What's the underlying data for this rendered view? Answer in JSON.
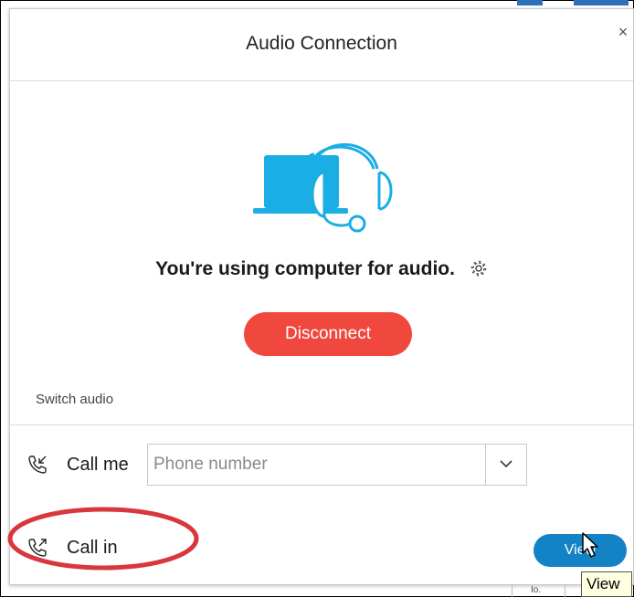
{
  "dialog": {
    "title": "Audio Connection",
    "close_icon": "close-icon",
    "status_text": "You're using computer for audio.",
    "disconnect_label": "Disconnect",
    "switch_audio_label": "Switch audio"
  },
  "call_me": {
    "label": "Call me",
    "placeholder": "Phone number",
    "value": "",
    "icon": "incoming-call-icon"
  },
  "call_in": {
    "label": "Call in",
    "icon": "outgoing-call-icon",
    "view_label": "View"
  },
  "tooltip": {
    "text": "View"
  },
  "background_fragment": {
    "text": "Io."
  },
  "colors": {
    "accent_blue": "#1383c6",
    "illustration_blue": "#1aaee5",
    "disconnect_red": "#f0483e",
    "annotation_red": "#d9363e"
  }
}
